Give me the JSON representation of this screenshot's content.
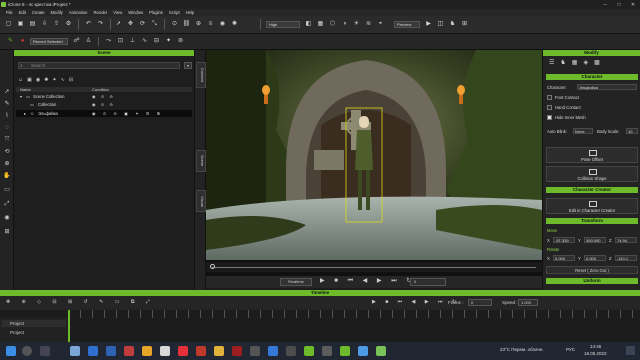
{
  "window": {
    "title": "iClone 8 - 4с крестом.iProject *"
  },
  "menu": [
    "File",
    "Edit",
    "Create",
    "Modify",
    "Animation",
    "Render",
    "View",
    "Window",
    "Plugins",
    "Script",
    "Help"
  ],
  "toolbar": {
    "quality": "High",
    "preview": "Preview",
    "record_mode": "Record Selected"
  },
  "scene": {
    "header": "Scene",
    "search_placeholder": "Search",
    "col_name": "Name",
    "col_condition": "Condition",
    "rows": [
      "Scene Collection",
      "Collection",
      "Эльфийка"
    ]
  },
  "side_tabs": [
    "Content",
    "Scene",
    "Visual"
  ],
  "playback": {
    "realtime": "Realtime",
    "frame": "0"
  },
  "modify": {
    "header": "Modify",
    "character_header": "Character",
    "character_label": "Character:",
    "character_name": "Эльфийка",
    "checks": [
      "Foot Contact",
      "Hand Contact",
      "Hide Inner Mesh"
    ],
    "autoblink_label": "Auto Blink:",
    "autoblink_value": "None",
    "bodyscale_label": "Body Scale:",
    "bodyscale_value": "10",
    "pose_offset": "Pose Offset",
    "collision_shape": "Collision Shape",
    "creator_header": "Character Creator",
    "edit_in_cc": "Edit in Character Creator",
    "transform_header": "Transform",
    "move_label": "Move",
    "move": {
      "x": "-97.339",
      "y": "300.000",
      "z": "74.94"
    },
    "rotate_label": "Rotate",
    "rotate": {
      "x": "0.000",
      "y": "0.000",
      "z": "-110.1"
    },
    "reset": "Reset ( Zero Out )",
    "more": "Uniform"
  },
  "timeline": {
    "header": "Timeline",
    "frame_label": "Frame :",
    "frame_value": "0",
    "speed_label": "Speed :",
    "speed_value": "1.000",
    "tracks": [
      "Project",
      "Project"
    ]
  },
  "taskbar": {
    "weather": "23°C Перем. облачн.",
    "lang": "РУС",
    "time": "14:45",
    "date": "18.05.2023"
  },
  "colors": {
    "accent": "#6dba2a"
  }
}
